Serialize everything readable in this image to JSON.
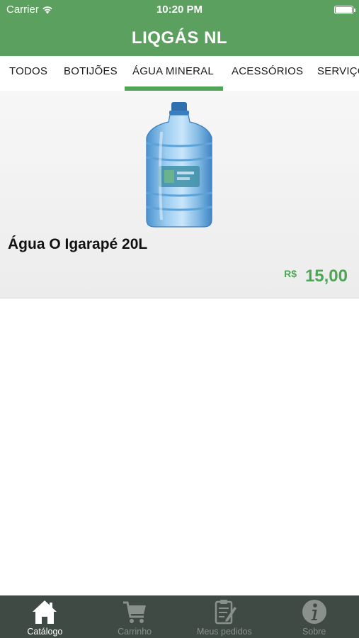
{
  "status": {
    "carrier": "Carrier",
    "time": "10:20 PM"
  },
  "header": {
    "title": "LIQGÁS NL"
  },
  "categories": {
    "items": [
      "TODOS",
      "BOTIJÕES",
      "ÁGUA MINERAL",
      "ACESSÓRIOS",
      "SERVIÇOS"
    ],
    "selected": "ÁGUA MINERAL"
  },
  "product": {
    "name": "Água O Igarapé 20L",
    "currency": "R$",
    "price": "15,00",
    "image_icon": "water-jug-image"
  },
  "tabbar": {
    "items": [
      {
        "label": "Catálogo",
        "icon": "home-icon",
        "active": true
      },
      {
        "label": "Carrinho",
        "icon": "cart-icon",
        "active": false
      },
      {
        "label": "Meus pedidos",
        "icon": "orders-icon",
        "active": false
      },
      {
        "label": "Sobre",
        "icon": "info-icon",
        "active": false
      }
    ]
  },
  "colors": {
    "brand_green": "#5ba05e",
    "price_green": "#4fa456",
    "tabbar_bg": "#3f4a44"
  }
}
